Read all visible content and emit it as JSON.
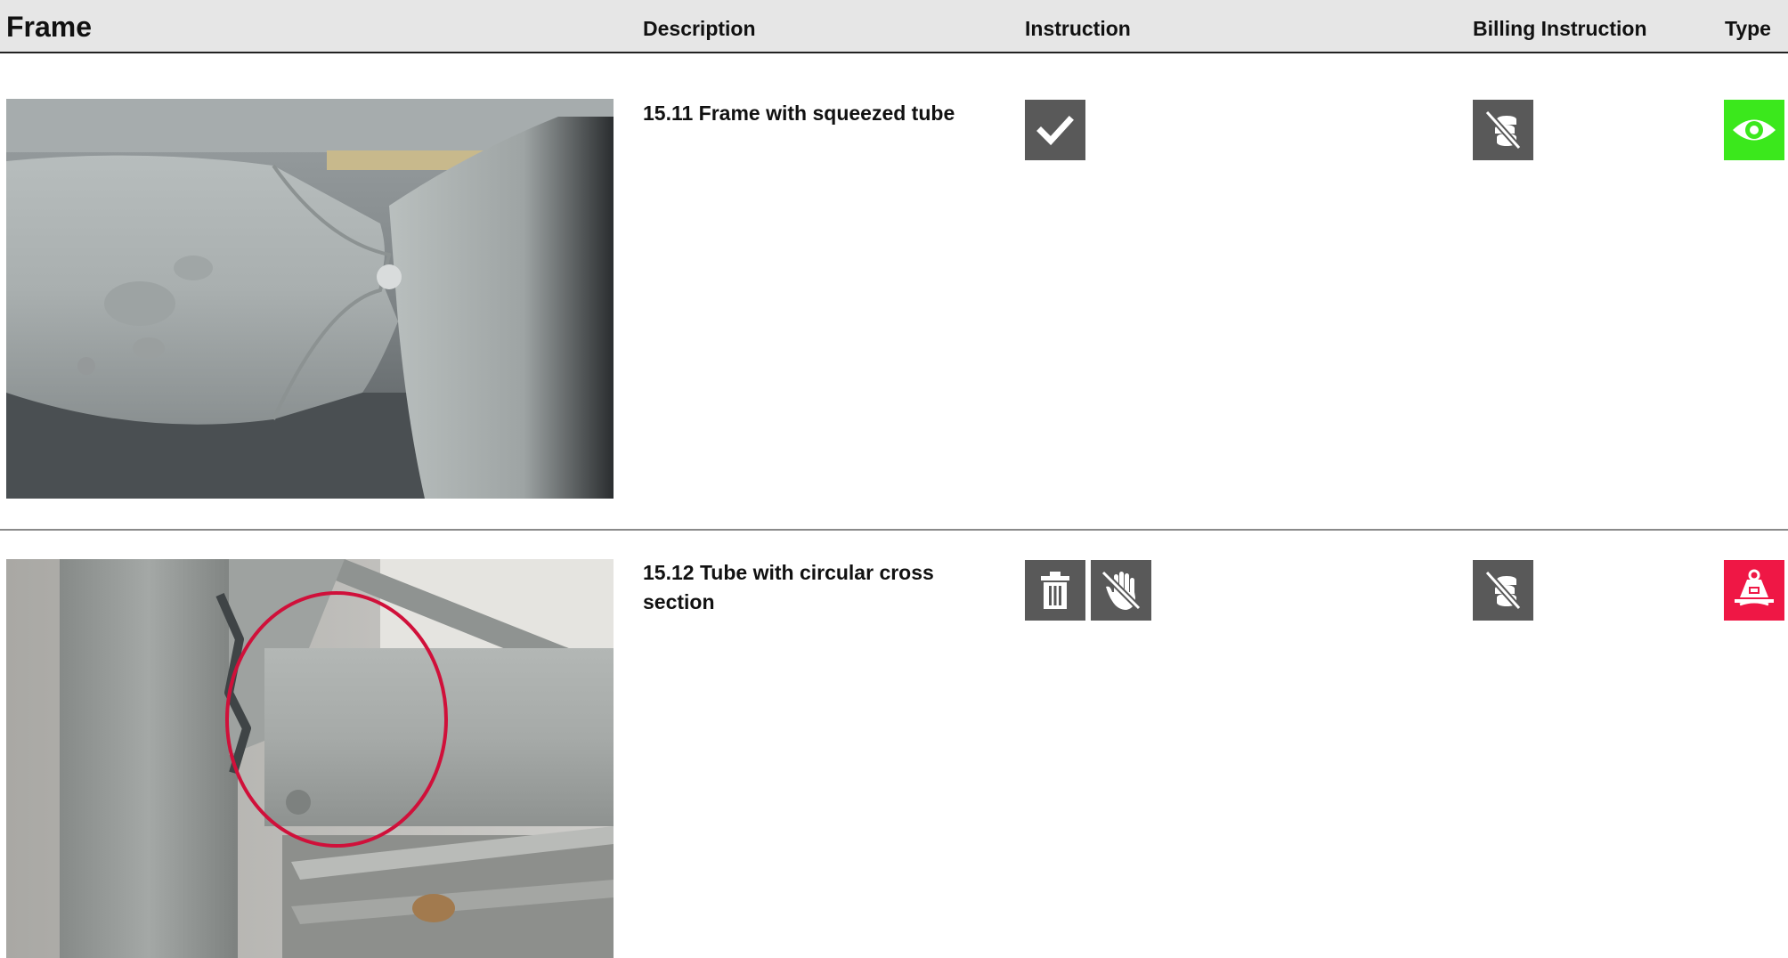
{
  "header": {
    "frame": "Frame",
    "description": "Description",
    "instruction": "Instruction",
    "billing_instruction": "Billing Instruction",
    "type": "Type"
  },
  "rows": [
    {
      "description": "15.11 Frame with squeezed tube",
      "instruction_icons": [
        "checkmark-icon"
      ],
      "billing_icon": "no-billing-coins-icon",
      "type_icon": "eye-icon",
      "type_color": "#3be81c"
    },
    {
      "description": "15.12 Tube with circular cross section",
      "instruction_icons": [
        "trash-icon",
        "do-not-touch-icon"
      ],
      "billing_icon": "no-billing-coins-icon",
      "type_icon": "weight-kg-icon",
      "type_color": "#ef1745"
    }
  ],
  "colors": {
    "header_bg": "#e6e6e6",
    "icon_bg": "#595959",
    "type_inspect": "#3be81c",
    "type_danger": "#ef1745",
    "marker_circle": "#d0103a"
  }
}
